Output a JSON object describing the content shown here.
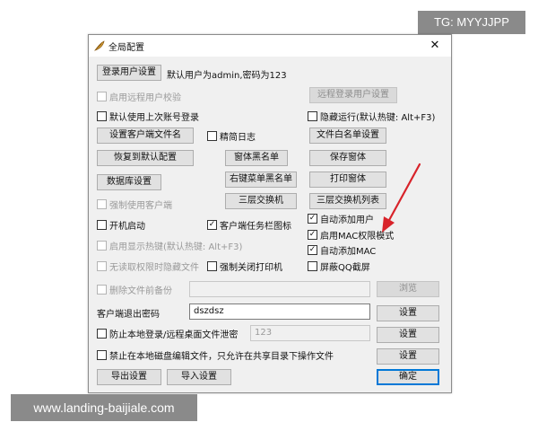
{
  "watermarks": {
    "top": "TG: MYYJJPP",
    "bottom": "www.landing-baijiale.com"
  },
  "dialog": {
    "title": "全局配置",
    "close_glyph": "✕",
    "login_user_button": "登录用户设置",
    "default_user_text": "默认用户为admin,密码为123",
    "remote_user_check": "启用远程用户校验",
    "remote_login_button": "远程登录用户设置",
    "last_account_check": "默认使用上次账号登录",
    "hidden_run_check": "隐藏运行(默认热键: Alt+F3)",
    "client_file_button": "设置客户端文件名",
    "lite_log_check": "精简日志",
    "file_whitelist_button": "文件白名单设置",
    "restore_default_button": "恢复到默认配置",
    "window_blacklist_button": "窗体黑名单",
    "save_window_button": "保存窗体",
    "db_settings_button": "数据库设置",
    "right_menu_blacklist_button": "右键菜单黑名单",
    "print_window_button": "打印窗体",
    "force_client_check": "强制使用客户端",
    "three_layer_switch_button": "三层交换机",
    "three_layer_switch_list_button": "三层交换机列表",
    "auto_add_user_check": "自动添加用户",
    "boot_start_check": "开机启动",
    "taskbar_icon_check": "客户端任务栏图标",
    "enable_mac_check": "启用MAC权限模式",
    "show_hotkey_check": "启用显示热键(默认热键: Alt+F3)",
    "auto_add_mac_check": "自动添加MAC",
    "no_permission_hide_check": "无读取权限时隐藏文件",
    "force_close_printer_check": "强制关闭打印机",
    "block_qq_screenshot_check": "屏蔽QQ截屏",
    "delete_backup_check": "删除文件前备份",
    "browse_button": "浏览",
    "exit_password_label": "客户端退出密码",
    "exit_password_value": "dszdsz",
    "settings_button": "设置",
    "prevent_leak_check": "防止本地登录/远程桌面文件泄密",
    "leak_value": "123",
    "forbid_local_edit_check": "禁止在本地磁盘编辑文件，只允许在共享目录下操作文件",
    "export_button": "导出设置",
    "import_button": "导入设置",
    "ok_button": "确定"
  },
  "colors": {
    "accent": "#0078d7",
    "arrow": "#d8232a"
  },
  "icons": {
    "check_mark": "✓",
    "app_icon": "feather-icon"
  }
}
